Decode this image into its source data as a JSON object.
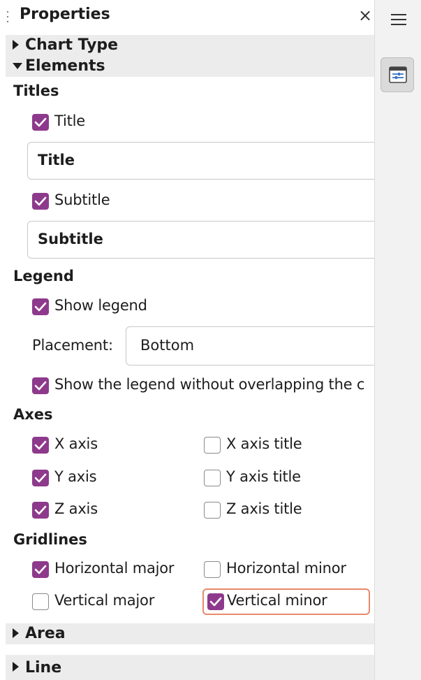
{
  "header": {
    "title": "Properties",
    "close_icon": "close-icon",
    "menu_icon": "hamburger-menu-icon"
  },
  "deck": {
    "properties_icon": "properties-deck-icon"
  },
  "sections": {
    "chart_type": "Chart Type",
    "elements": "Elements",
    "area": "Area",
    "line": "Line"
  },
  "titles": {
    "group": "Titles",
    "title_checkbox": {
      "label": "Title",
      "checked": true
    },
    "title_value": "Title",
    "subtitle_checkbox": {
      "label": "Subtitle",
      "checked": true
    },
    "subtitle_value": "Subtitle"
  },
  "legend": {
    "group": "Legend",
    "show_legend": {
      "label": "Show legend",
      "checked": true
    },
    "placement_label": "Placement:",
    "placement_value": "Bottom",
    "no_overlap": {
      "label": "Show the legend without overlapping the c",
      "checked": true
    }
  },
  "axes": {
    "group": "Axes",
    "x_axis": {
      "label": "X axis",
      "checked": true
    },
    "y_axis": {
      "label": "Y axis",
      "checked": true
    },
    "z_axis": {
      "label": "Z axis",
      "checked": true
    },
    "x_axis_title": {
      "label": "X axis title",
      "checked": false
    },
    "y_axis_title": {
      "label": "Y axis title",
      "checked": false
    },
    "z_axis_title": {
      "label": "Z axis title",
      "checked": false
    }
  },
  "gridlines": {
    "group": "Gridlines",
    "horizontal_major": {
      "label": "Horizontal major",
      "checked": true
    },
    "horizontal_minor": {
      "label": "Horizontal minor",
      "checked": false
    },
    "vertical_major": {
      "label": "Vertical major",
      "checked": false
    },
    "vertical_minor": {
      "label": "Vertical minor",
      "checked": true
    }
  },
  "colors": {
    "checkbox_accent": "#8e3a8c",
    "focus_ring": "#e8896a",
    "section_header_bg": "#ececec"
  }
}
